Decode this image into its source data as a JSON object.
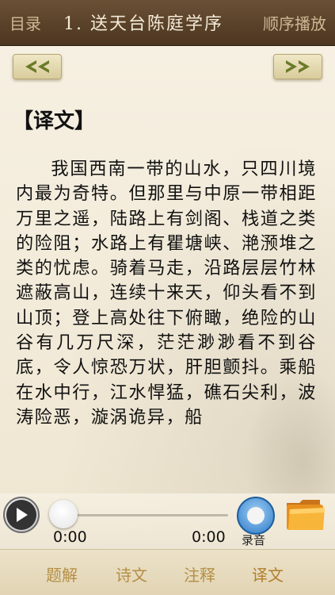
{
  "header": {
    "menu_label": "目录",
    "title": "1. 送天台陈庭学序",
    "mode_label": "顺序播放"
  },
  "nav": {
    "prev_icon": "double-chevron-left-icon",
    "next_icon": "double-chevron-right-icon"
  },
  "content": {
    "section_heading": "【译文】",
    "paragraph": "我国西南一带的山水，只四川境内最为奇特。但那里与中原一带相距万里之遥，陆路上有剑阁、栈道之类的险阻；水路上有瞿塘峡、滟滪堆之类的忧虑。骑着马走，沿路层层竹林遮蔽高山，连续十来天，仰头看不到山顶；登上高处往下俯瞰，绝险的山谷有几万尺深，茫茫渺渺看不到谷底，令人惊恐万状，肝胆颤抖。乘船在水中行，江水悍猛，礁石尖利，波涛险恶，漩涡诡异，船"
  },
  "player": {
    "current_time": "0:00",
    "total_time": "0:00",
    "progress": 0,
    "record_label": "录音",
    "play_icon": "play-icon",
    "record_icon": "record-icon",
    "folder_icon": "folder-icon"
  },
  "tabs": [
    {
      "label": "题解"
    },
    {
      "label": "诗文"
    },
    {
      "label": "注释"
    },
    {
      "label": "译文"
    }
  ],
  "colors": {
    "header_bg": "#5a412a",
    "tab_text": "#b48f45",
    "record_blue": "#2c79c8",
    "folder_orange": "#f2a024"
  }
}
